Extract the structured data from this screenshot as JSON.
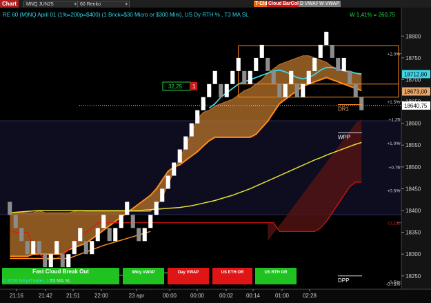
{
  "toolbar": {
    "tab_label": "Chart",
    "instrument": "MNQ JUN25",
    "bar_type": "60 Renko",
    "buttons": [
      {
        "label": "T-Cld",
        "bg": "#e8670a",
        "fg": "#fff"
      },
      {
        "label": "Cloud",
        "bg": "#d01717",
        "fg": "#fff"
      },
      {
        "label": "BarCol",
        "bg": "#d01717",
        "fg": "#fff"
      },
      {
        "label": "D VWAP",
        "bg": "#7a7a7a",
        "fg": "#ddd"
      },
      {
        "label": "W VWAP",
        "bg": "#7a7a7a",
        "fg": "#ddd"
      }
    ]
  },
  "header": {
    "indicator_text": "RE 60 (M)NQ April 01  (1%=200p=$400) (1 Brick=$30 Micro or $300 Mini), US Dy RTH % , T3 MA SL",
    "pct_text": "W 1,41% = 260,75"
  },
  "footer": {
    "copyright": "© 2025 NinjaTrader, LLC",
    "ma_label": "T3 MA SL",
    "buttons": [
      {
        "label": "Fast Cloud Break Out",
        "color": "#1fc21f"
      },
      {
        "label": "Wkly VWAP",
        "color": "#1fc21f"
      },
      {
        "label": "Day VWAP",
        "color": "#e01515"
      },
      {
        "label": "US ETH OR",
        "color": "#e01515"
      },
      {
        "label": "US RTH OR",
        "color": "#1fc21f"
      }
    ]
  },
  "colors": {
    "brick_up": "#ffffff",
    "brick_down": "#8c8c8c",
    "cloud_bull": "#b8742c",
    "cloud_bear": "#5a1414",
    "vwap_cyan": "#3fd6e8",
    "ma_yellow": "#e8e030",
    "orange": "#ff8c1a",
    "red": "#e01515",
    "green": "#22dd44"
  },
  "chart_data": {
    "type": "renko",
    "brick_size": 30,
    "y_ticks": [
      18250,
      18300,
      18350,
      18400,
      18450,
      18500,
      18550,
      18600,
      18650,
      18700,
      18750,
      18800
    ],
    "ylim": [
      18237,
      18821
    ],
    "x_ticks": [
      "21:16",
      "21:42",
      "21:51",
      "22:00",
      "23 apr",
      "00:00",
      "00:00",
      "00:02",
      "00:14",
      "01:00",
      "02:28"
    ],
    "price_labels": [
      {
        "value": 18712.8,
        "text": "18712,80",
        "bg": "#3fd6e8",
        "fg": "#000"
      },
      {
        "value": 18673.0,
        "text": "18673,00",
        "bg": "#e8a66a",
        "fg": "#000"
      },
      {
        "value": 18640.75,
        "text": "18640,75",
        "bg": "#ffffff",
        "fg": "#000"
      }
    ],
    "pct_levels": [
      {
        "text": "+2.0%",
        "value": 18760
      },
      {
        "text": "+1.5%",
        "value": 18650
      },
      {
        "text": "+1.25",
        "value": 18610
      },
      {
        "text": "+1.0%",
        "value": 18555
      },
      {
        "text": "+0.75",
        "value": 18500
      },
      {
        "text": "+0.5%",
        "value": 18447
      },
      {
        "text": "CLOE",
        "value": 18372
      },
      {
        "text": "-0.5%",
        "value": 18237
      },
      {
        "text": "-0.75%",
        "value": 18180
      }
    ],
    "levels": [
      {
        "name": "DR1",
        "text": "DR1",
        "value": 18643
      },
      {
        "name": "WPP",
        "text": "WPP",
        "value": 18578
      },
      {
        "name": "DPP",
        "text": "DPP",
        "value": 18250
      }
    ],
    "position_marker": {
      "text": "32,25",
      "qty": "1",
      "value": 18685
    },
    "bricks": [
      {
        "dir": "down",
        "open": 18420,
        "close": 18390
      },
      {
        "dir": "down",
        "open": 18390,
        "close": 18360
      },
      {
        "dir": "down",
        "open": 18360,
        "close": 18330
      },
      {
        "dir": "down",
        "open": 18330,
        "close": 18300
      },
      {
        "dir": "up",
        "open": 18300,
        "close": 18330
      },
      {
        "dir": "down",
        "open": 18330,
        "close": 18300
      },
      {
        "dir": "down",
        "open": 18300,
        "close": 18270
      },
      {
        "dir": "up",
        "open": 18270,
        "close": 18300
      },
      {
        "dir": "up",
        "open": 18300,
        "close": 18330
      },
      {
        "dir": "down",
        "open": 18300,
        "close": 18270
      },
      {
        "dir": "up",
        "open": 18270,
        "close": 18300
      },
      {
        "dir": "up",
        "open": 18300,
        "close": 18330
      },
      {
        "dir": "up",
        "open": 18330,
        "close": 18360
      },
      {
        "dir": "down",
        "open": 18330,
        "close": 18300
      },
      {
        "dir": "up",
        "open": 18300,
        "close": 18330
      },
      {
        "dir": "up",
        "open": 18330,
        "close": 18360
      },
      {
        "dir": "up",
        "open": 18360,
        "close": 18390
      },
      {
        "dir": "down",
        "open": 18360,
        "close": 18330
      },
      {
        "dir": "up",
        "open": 18330,
        "close": 18360
      },
      {
        "dir": "up",
        "open": 18360,
        "close": 18390
      },
      {
        "dir": "up",
        "open": 18390,
        "close": 18420
      },
      {
        "dir": "down",
        "open": 18390,
        "close": 18360
      },
      {
        "dir": "down",
        "open": 18360,
        "close": 18330
      },
      {
        "dir": "up",
        "open": 18330,
        "close": 18360
      },
      {
        "dir": "up",
        "open": 18360,
        "close": 18390
      },
      {
        "dir": "up",
        "open": 18390,
        "close": 18420
      },
      {
        "dir": "up",
        "open": 18420,
        "close": 18450
      },
      {
        "dir": "up",
        "open": 18450,
        "close": 18480
      },
      {
        "dir": "up",
        "open": 18480,
        "close": 18510
      },
      {
        "dir": "up",
        "open": 18510,
        "close": 18540
      },
      {
        "dir": "up",
        "open": 18540,
        "close": 18570
      },
      {
        "dir": "up",
        "open": 18570,
        "close": 18600
      },
      {
        "dir": "up",
        "open": 18600,
        "close": 18630
      },
      {
        "dir": "up",
        "open": 18630,
        "close": 18660
      },
      {
        "dir": "up",
        "open": 18660,
        "close": 18690
      },
      {
        "dir": "up",
        "open": 18690,
        "close": 18720
      },
      {
        "dir": "down",
        "open": 18690,
        "close": 18660
      },
      {
        "dir": "up",
        "open": 18660,
        "close": 18690
      },
      {
        "dir": "up",
        "open": 18690,
        "close": 18720
      },
      {
        "dir": "up",
        "open": 18720,
        "close": 18750
      },
      {
        "dir": "down",
        "open": 18720,
        "close": 18690
      },
      {
        "dir": "up",
        "open": 18690,
        "close": 18720
      },
      {
        "dir": "up",
        "open": 18720,
        "close": 18750
      },
      {
        "dir": "up",
        "open": 18750,
        "close": 18780
      },
      {
        "dir": "down",
        "open": 18750,
        "close": 18720
      },
      {
        "dir": "down",
        "open": 18720,
        "close": 18690
      },
      {
        "dir": "down",
        "open": 18690,
        "close": 18660
      },
      {
        "dir": "up",
        "open": 18660,
        "close": 18690
      },
      {
        "dir": "up",
        "open": 18690,
        "close": 18720
      },
      {
        "dir": "down",
        "open": 18690,
        "close": 18660
      },
      {
        "dir": "up",
        "open": 18660,
        "close": 18690
      },
      {
        "dir": "up",
        "open": 18690,
        "close": 18720
      },
      {
        "dir": "up",
        "open": 18720,
        "close": 18750
      },
      {
        "dir": "up",
        "open": 18750,
        "close": 18780
      },
      {
        "dir": "up",
        "open": 18780,
        "close": 18810
      },
      {
        "dir": "down",
        "open": 18780,
        "close": 18750
      },
      {
        "dir": "down",
        "open": 18750,
        "close": 18720
      },
      {
        "dir": "up",
        "open": 18720,
        "close": 18750
      },
      {
        "dir": "down",
        "open": 18720,
        "close": 18690
      },
      {
        "dir": "down",
        "open": 18690,
        "close": 18660
      },
      {
        "dir": "down",
        "open": 18660,
        "close": 18630
      }
    ],
    "cloud_upper": [
      18395,
      18395,
      18395,
      18395,
      18395,
      18400,
      18395,
      18395,
      18395,
      18395,
      18395,
      18398,
      18400,
      18398,
      18398,
      18398,
      18398,
      18398,
      18398,
      18398,
      18398,
      18398,
      18398,
      18398,
      18398,
      18410,
      18430,
      18460,
      18490,
      18520,
      18550,
      18580,
      18610,
      18625,
      18630,
      18640,
      18645,
      18650,
      18655,
      18665,
      18675,
      18680,
      18690,
      18700,
      18715,
      18725,
      18735,
      18740,
      18745,
      18750,
      18755,
      18755,
      18750,
      18745,
      18740,
      18730,
      18725,
      18720,
      18720,
      18715,
      18710
    ],
    "cloud_lower": [
      18295,
      18295,
      18295,
      18295,
      18300,
      18300,
      18300,
      18300,
      18300,
      18300,
      18310,
      18315,
      18320,
      18325,
      18335,
      18345,
      18355,
      18365,
      18375,
      18385,
      18395,
      18405,
      18415,
      18425,
      18435,
      18450,
      18470,
      18490,
      18500,
      18505,
      18515,
      18525,
      18535,
      18548,
      18560,
      18568,
      18568,
      18568,
      18568,
      18568,
      18568,
      18568,
      18575,
      18590,
      18605,
      18625,
      18645,
      18655,
      18665,
      18675,
      18685,
      18690,
      18695,
      18700,
      18705,
      18700,
      18695,
      18690,
      18685,
      18680,
      18675
    ],
    "red_line": [
      18355,
      18350,
      18350,
      18350,
      18320,
      18300,
      18290,
      18285,
      18290,
      18300,
      18310,
      18325,
      18340,
      18350,
      18360,
      18372,
      18372,
      18372,
      18372,
      18372,
      18372,
      18372,
      18372,
      18372,
      18372,
      18372,
      18372,
      18372,
      18372,
      18372,
      18372,
      18372,
      18372,
      18372,
      18372,
      18372,
      18372,
      18372,
      18372,
      18372,
      18372,
      18372,
      18372,
      18372,
      18372,
      18372,
      18352,
      18352,
      18352,
      18352,
      18352,
      18352,
      18352,
      18360,
      18375,
      18395,
      18415,
      18435,
      18455,
      18465,
      18465
    ],
    "yellow_ma": [
      18395,
      18396,
      18397,
      18398,
      18399,
      18400,
      18400,
      18400,
      18400,
      18400,
      18400,
      18400,
      18400,
      18400,
      18400,
      18400,
      18400,
      18400,
      18400,
      18400,
      18400,
      18400,
      18400,
      18401,
      18402,
      18403,
      18404,
      18405,
      18406,
      18407,
      18409,
      18411,
      18414,
      18417,
      18420,
      18423,
      18427,
      18431,
      18435,
      18440,
      18445,
      18450,
      18456,
      18462,
      18468,
      18474,
      18480,
      18486,
      18492,
      18498,
      18504,
      18510,
      18516,
      18521,
      18527,
      18532,
      18537,
      18542,
      18547,
      18552,
      18556
    ],
    "cyan_vwap": [
      null,
      null,
      null,
      null,
      null,
      null,
      null,
      null,
      null,
      null,
      null,
      null,
      null,
      null,
      null,
      null,
      null,
      null,
      null,
      null,
      null,
      null,
      null,
      null,
      null,
      null,
      null,
      null,
      null,
      null,
      null,
      null,
      null,
      null,
      18635,
      18645,
      18660,
      18670,
      18680,
      18690,
      18695,
      18700,
      18705,
      18710,
      18715,
      18720,
      18722,
      18718,
      18712,
      18705,
      18702,
      18705,
      18712,
      18722,
      18728,
      18728,
      18725,
      18720,
      18718,
      18715,
      18713
    ],
    "bear_cloud_top": [
      18610,
      18610,
      18610,
      18610,
      18610
    ],
    "bear_cloud_idx": [
      52,
      54,
      56,
      58,
      60
    ]
  }
}
